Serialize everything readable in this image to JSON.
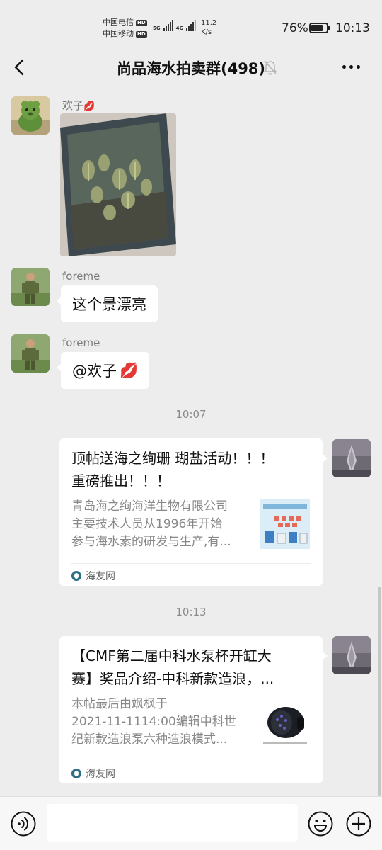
{
  "status_bar": {
    "carrier_1": "中国电信",
    "carrier_2": "中国移动",
    "hd": "HD",
    "net_1": "5G",
    "net_2": "4G",
    "speed_value": "11.2",
    "speed_unit": "K/s",
    "battery_percent": "76%",
    "battery_level": 0.76,
    "time": "10:13"
  },
  "header": {
    "title": "尚品海水拍卖群(498)",
    "icons": [
      "back-icon",
      "mute-bell-icon",
      "more-icon"
    ]
  },
  "messages": {
    "m1": {
      "sender": "欢子",
      "sender_emoji": "💋",
      "type": "image",
      "image": "aquarium-photo"
    },
    "m2": {
      "sender": "foreme",
      "text": "这个景漂亮"
    },
    "m3": {
      "sender": "foreme",
      "text": "@欢子",
      "emoji": "💋"
    },
    "ts1": "10:07",
    "card1": {
      "title_line1": "顶帖送海之绚珊 瑚盐活动！！！",
      "title_line2": "重磅推出！！！",
      "desc_line1": "青岛海之绚海洋生物有限公司",
      "desc_line2": "主要技术人员从1996年开始",
      "desc_line3": "参与海水素的研发与生产,有...",
      "source": "海友网"
    },
    "ts2": "10:13",
    "card2": {
      "title_line1": "【CMF第二届中科水泵杯开缸大",
      "title_line2": "赛】奖品介绍-中科新款造浪，...",
      "desc_line1": "本帖最后由飒枫于",
      "desc_line2": "2021-11-1114:00编辑中科世",
      "desc_line3": "纪新款造浪泵六种造浪模式...",
      "source": "海友网"
    }
  },
  "input_bar": {
    "value": "",
    "icons": [
      "voice-icon",
      "emoji-icon",
      "plus-icon"
    ]
  }
}
